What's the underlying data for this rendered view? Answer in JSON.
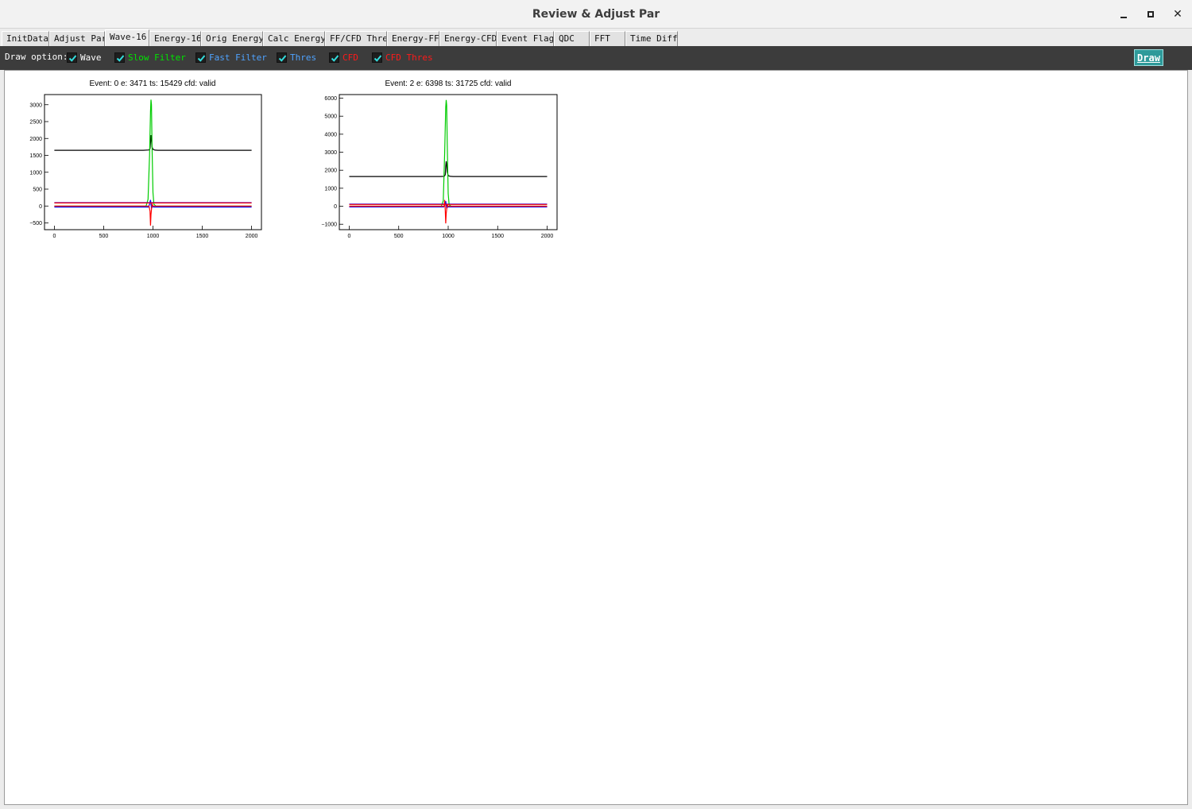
{
  "window": {
    "title": "Review & Adjust Par"
  },
  "tabs": [
    {
      "label": "InitData"
    },
    {
      "label": "Adjust Par"
    },
    {
      "label": "Wave-16",
      "active": true
    },
    {
      "label": "Energy-16"
    },
    {
      "label": "Orig Energy"
    },
    {
      "label": "Calc Energy"
    },
    {
      "label": "FF/CFD Thre"
    },
    {
      "label": "Energy-FF"
    },
    {
      "label": "Energy-CFD"
    },
    {
      "label": "Event Flag"
    },
    {
      "label": "QDC"
    },
    {
      "label": "FFT"
    },
    {
      "label": "Time Diff"
    }
  ],
  "toolbar": {
    "draw_option_label": "Draw option:",
    "options": [
      {
        "label": "Wave",
        "checked": true,
        "color": "#ffffff"
      },
      {
        "label": "Slow Filter",
        "checked": true,
        "color": "#00e600"
      },
      {
        "label": "Fast Filter",
        "checked": true,
        "color": "#4fa3ff"
      },
      {
        "label": "Thres",
        "checked": true,
        "color": "#4fa3ff"
      },
      {
        "label": "CFD",
        "checked": true,
        "color": "#ff1a1a"
      },
      {
        "label": "CFD Thres",
        "checked": true,
        "color": "#ff1a1a"
      }
    ],
    "draw_button": "Draw"
  },
  "chart_data": [
    {
      "type": "line",
      "title": "Event: 0   e: 3471   ts: 15429   cfd: valid",
      "xlim": [
        -100,
        2100
      ],
      "ylim": [
        -700,
        3300
      ],
      "xticks": [
        0,
        500,
        1000,
        1500,
        2000
      ],
      "yticks": [
        -500,
        0,
        500,
        1000,
        1500,
        2000,
        2500,
        3000
      ],
      "series": [
        {
          "key": "wave",
          "color": "#000000",
          "x": [
            0,
            900,
            960,
            970,
            975,
            980,
            985,
            990,
            1000,
            1020,
            1050,
            2000
          ],
          "y": [
            1650,
            1650,
            1660,
            1700,
            1900,
            2100,
            1950,
            1750,
            1680,
            1655,
            1650,
            1650
          ]
        },
        {
          "key": "slow_filter",
          "color": "#00cc00",
          "x": [
            0,
            930,
            950,
            965,
            975,
            980,
            985,
            990,
            1000,
            1010,
            1030,
            2000
          ],
          "y": [
            0,
            0,
            200,
            1500,
            2800,
            3150,
            3000,
            1800,
            400,
            50,
            0,
            0
          ]
        },
        {
          "key": "fast_filter",
          "color": "#0000ff",
          "x": [
            0,
            955,
            965,
            975,
            985,
            995,
            1010,
            2000
          ],
          "y": [
            -30,
            -30,
            50,
            180,
            -60,
            -20,
            -30,
            -30
          ]
        },
        {
          "key": "thres",
          "color": "#0000ff",
          "x": [
            0,
            2000
          ],
          "y": [
            100,
            100
          ]
        },
        {
          "key": "cfd",
          "color": "#ff0000",
          "x": [
            0,
            960,
            970,
            975,
            980,
            990,
            1000,
            2000
          ],
          "y": [
            0,
            0,
            -150,
            -580,
            -250,
            60,
            0,
            0
          ]
        },
        {
          "key": "cfd_thres",
          "color": "#ff0000",
          "x": [
            0,
            2000
          ],
          "y": [
            90,
            90
          ]
        }
      ]
    },
    {
      "type": "line",
      "title": "Event: 2   e: 6398   ts: 31725   cfd: valid",
      "xlim": [
        -100,
        2100
      ],
      "ylim": [
        -1300,
        6200
      ],
      "xticks": [
        0,
        500,
        1000,
        1500,
        2000
      ],
      "yticks": [
        -1000,
        0,
        1000,
        2000,
        3000,
        4000,
        5000,
        6000
      ],
      "series": [
        {
          "key": "wave",
          "color": "#000000",
          "x": [
            0,
            920,
            960,
            970,
            975,
            980,
            985,
            990,
            1000,
            1020,
            1050,
            2000
          ],
          "y": [
            1650,
            1650,
            1660,
            1750,
            2200,
            2500,
            2300,
            1900,
            1700,
            1660,
            1650,
            1650
          ]
        },
        {
          "key": "slow_filter",
          "color": "#00cc00",
          "x": [
            0,
            930,
            950,
            965,
            975,
            980,
            985,
            990,
            1000,
            1010,
            1030,
            2000
          ],
          "y": [
            0,
            0,
            300,
            3000,
            5500,
            5900,
            5600,
            3500,
            700,
            80,
            0,
            0
          ]
        },
        {
          "key": "fast_filter",
          "color": "#0000ff",
          "x": [
            0,
            955,
            965,
            975,
            985,
            995,
            1010,
            2000
          ],
          "y": [
            -40,
            -40,
            60,
            280,
            -120,
            -30,
            -40,
            -40
          ]
        },
        {
          "key": "thres",
          "color": "#0000ff",
          "x": [
            0,
            2000
          ],
          "y": [
            120,
            120
          ]
        },
        {
          "key": "cfd",
          "color": "#ff0000",
          "x": [
            0,
            960,
            965,
            970,
            975,
            980,
            990,
            1000,
            2000
          ],
          "y": [
            0,
            0,
            350,
            -200,
            -950,
            -400,
            80,
            0,
            0
          ]
        },
        {
          "key": "cfd_thres",
          "color": "#ff0000",
          "x": [
            0,
            2000
          ],
          "y": [
            100,
            100
          ]
        }
      ]
    }
  ]
}
